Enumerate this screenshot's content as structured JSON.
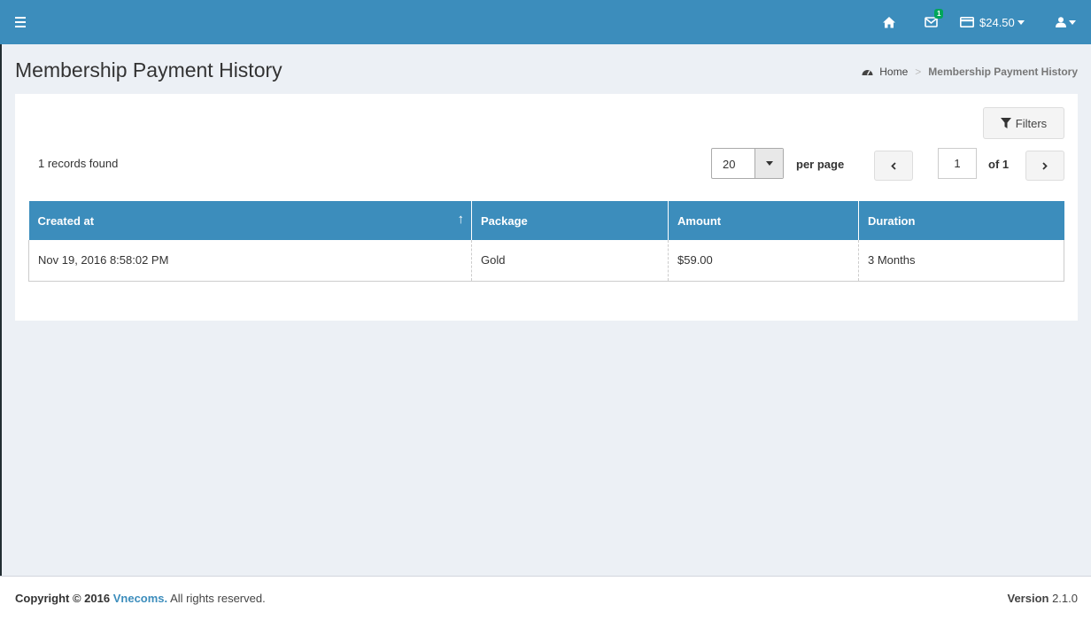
{
  "header": {
    "balance": "$24.50",
    "mail_badge": "1",
    "icons": [
      "menu-icon",
      "home-icon",
      "envelope-icon",
      "credit-card-icon",
      "user-icon"
    ],
    "color": "#3c8dbc"
  },
  "page": {
    "title": "Membership Payment History"
  },
  "breadcrumb": {
    "home": "Home",
    "separator": ">",
    "current": "Membership Payment History"
  },
  "toolbar": {
    "filters_label": "Filters",
    "records_found": "1 records found",
    "per_page_value": "20",
    "per_page_label": "per page",
    "current_page": "1",
    "of_label": "of 1"
  },
  "table": {
    "columns": [
      "Created at",
      "Package",
      "Amount",
      "Duration"
    ],
    "sort_indicator": "↑",
    "rows": [
      [
        "Nov 19, 2016 8:58:02 PM",
        "Gold",
        "$59.00",
        "3 Months"
      ]
    ]
  },
  "footer": {
    "copyright_prefix": "Copyright © 2016",
    "company": "Vnecoms.",
    "rights": "All rights reserved.",
    "version_label": "Version",
    "version": "2.1.0"
  }
}
